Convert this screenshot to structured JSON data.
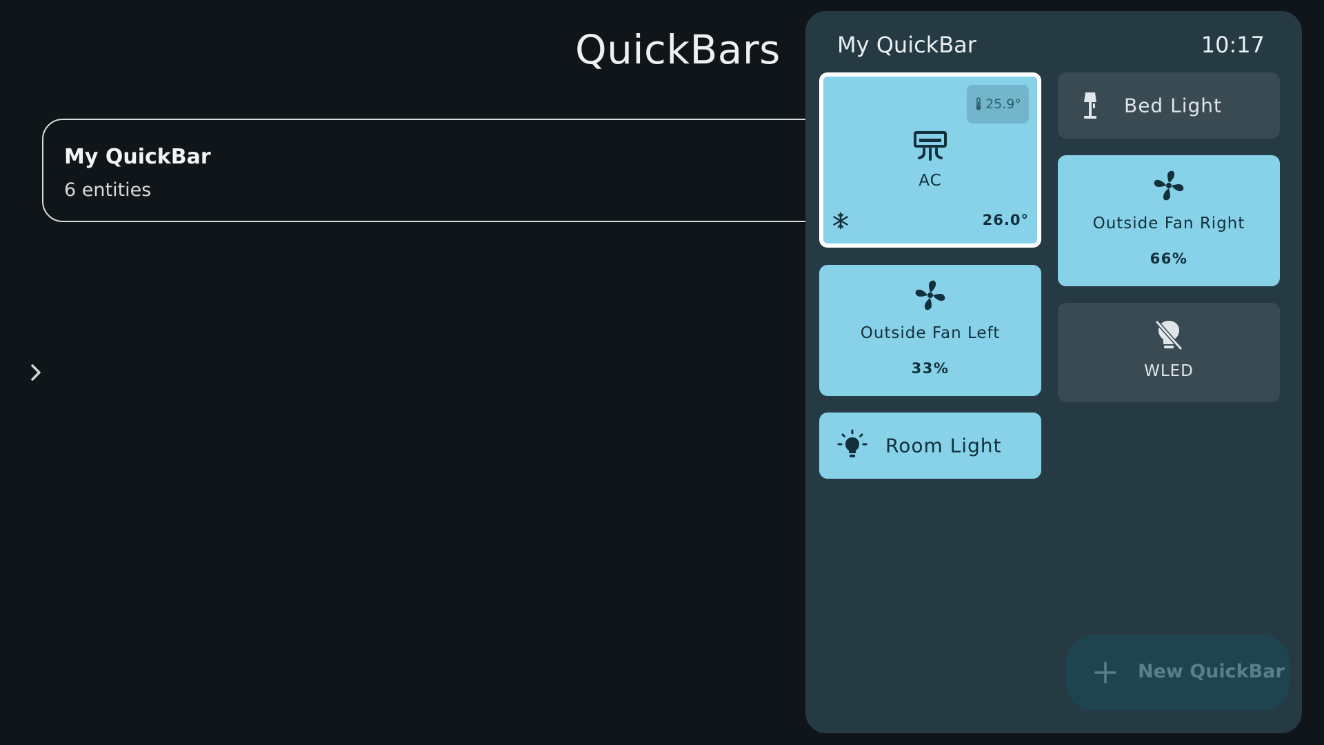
{
  "page": {
    "title": "QuickBars"
  },
  "quickbar_list": [
    {
      "name": "My QuickBar",
      "count": "6 entities"
    }
  ],
  "panel": {
    "title": "My QuickBar",
    "time": "10:17",
    "tiles": {
      "ac": {
        "label": "AC",
        "current_temp": "25.9°",
        "setpoint": "26.0°",
        "state": "on",
        "icon": "air-conditioner-icon",
        "mode_icon": "snowflake-icon",
        "badge_icon": "thermometer-icon"
      },
      "bed_light": {
        "label": "Bed Light",
        "state": "off",
        "icon": "floor-lamp-icon"
      },
      "outside_fan_right": {
        "label": "Outside Fan Right",
        "value": "66%",
        "state": "on",
        "icon": "fan-icon"
      },
      "outside_fan_left": {
        "label": "Outside Fan Left",
        "value": "33%",
        "state": "on",
        "icon": "fan-icon"
      },
      "wled": {
        "label": "WLED",
        "state": "off",
        "icon": "lightbulb-off-icon"
      },
      "room_light": {
        "label": "Room Light",
        "state": "on",
        "icon": "lightbulb-on-icon"
      }
    },
    "new_button": {
      "label": "New QuickBar",
      "icon": "plus-icon"
    }
  },
  "colors": {
    "background": "#0f1519",
    "panel": "#263a44",
    "tile_on": "#87d1e9",
    "tile_off": "#394a52",
    "tile_on_text": "#12303b",
    "focus_border": "#ffffff",
    "new_button_bg": "#1e4450"
  }
}
